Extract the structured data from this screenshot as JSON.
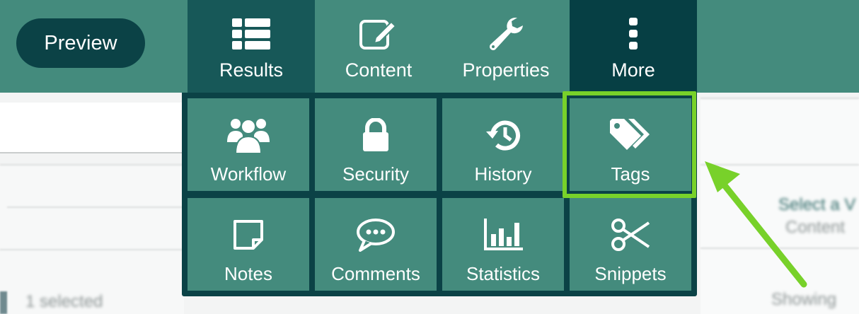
{
  "toolbar": {
    "preview_label": "Preview",
    "tabs": [
      {
        "label": "Results",
        "icon": "list-icon"
      },
      {
        "label": "Content",
        "icon": "edit-icon"
      },
      {
        "label": "Properties",
        "icon": "wrench-icon"
      },
      {
        "label": "More",
        "icon": "kebab-icon"
      }
    ]
  },
  "more_menu": {
    "items": [
      {
        "label": "Workflow",
        "icon": "users-icon"
      },
      {
        "label": "Security",
        "icon": "lock-icon"
      },
      {
        "label": "History",
        "icon": "history-icon"
      },
      {
        "label": "Tags",
        "icon": "tags-icon",
        "highlighted": true
      },
      {
        "label": "Notes",
        "icon": "note-icon"
      },
      {
        "label": "Comments",
        "icon": "comments-icon"
      },
      {
        "label": "Statistics",
        "icon": "chart-icon"
      },
      {
        "label": "Snippets",
        "icon": "scissors-icon"
      }
    ]
  },
  "background": {
    "selected_text": "1 selected",
    "select_text": "Select a V",
    "content_text": "Content",
    "showing_text": "Showing"
  },
  "colors": {
    "toolbar": "#448b7d",
    "active_tab": "#175858",
    "more_tab": "#063f44",
    "dark": "#0b4246",
    "highlight": "#78d12a"
  }
}
